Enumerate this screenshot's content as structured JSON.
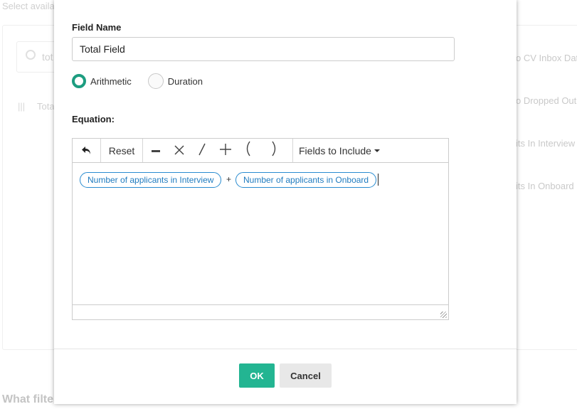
{
  "background": {
    "hint_text": "Select availa",
    "search_value": "tot",
    "list_item": "Tota",
    "right_column": [
      "o CV Inbox Date",
      "o Dropped Out",
      "its In Interview",
      "its In Onboard"
    ],
    "bottom_heading": "What filte"
  },
  "modal": {
    "field_name_label": "Field Name",
    "field_name_value": "Total Field",
    "type_options": [
      {
        "label": "Arithmetic",
        "selected": true
      },
      {
        "label": "Duration",
        "selected": false
      }
    ],
    "equation_label": "Equation:",
    "toolbar": {
      "undo_icon": "undo-arrow-icon",
      "reset_label": "Reset",
      "operators": [
        "−",
        "×",
        "/",
        "+",
        "(",
        ")"
      ],
      "fields_dropdown_label": "Fields to Include"
    },
    "equation": {
      "terms": [
        "Number of applicants in Interview",
        "Number of applicants in Onboard"
      ],
      "operator": "+"
    },
    "ok_label": "OK",
    "cancel_label": "Cancel"
  },
  "colors": {
    "accent": "#1d9d80",
    "ok_button": "#23b592",
    "chip_border": "#2a8cd0",
    "chip_text": "#1f7bbf"
  }
}
